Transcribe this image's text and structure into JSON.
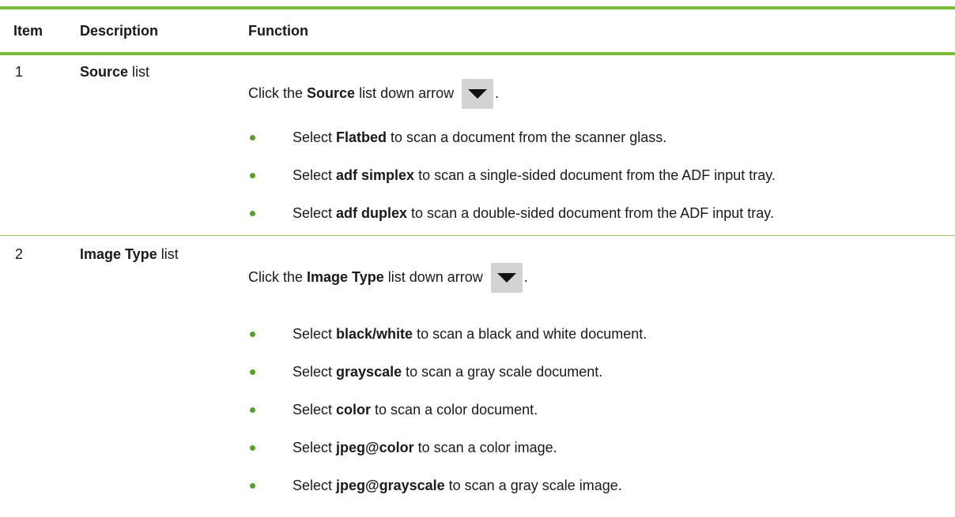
{
  "table": {
    "headers": {
      "item": "Item",
      "description": "Description",
      "function": "Function"
    },
    "rows": [
      {
        "item": "1",
        "desc_bold": "Source",
        "desc_rest": " list",
        "intro_pre": "Click the ",
        "intro_bold": "Source",
        "intro_post": " list down arrow",
        "intro_end": ".",
        "bullets": [
          {
            "pre": "Select ",
            "bold": "Flatbed",
            "post": " to scan a document from the scanner glass."
          },
          {
            "pre": "Select ",
            "bold": "adf simplex",
            "post": " to scan a single-sided document from the ADF input tray."
          },
          {
            "pre": "Select ",
            "bold": "adf duplex",
            "post": " to scan a double-sided document from the ADF input tray."
          }
        ]
      },
      {
        "item": "2",
        "desc_bold": "Image Type",
        "desc_rest": " list",
        "intro_pre": "Click the ",
        "intro_bold": "Image Type",
        "intro_post": " list down arrow",
        "intro_end": ".",
        "bullets": [
          {
            "pre": "Select ",
            "bold": "black/white",
            "post": " to scan a black and white document."
          },
          {
            "pre": "Select ",
            "bold": "grayscale",
            "post": " to scan a gray scale document."
          },
          {
            "pre": "Select ",
            "bold": "color",
            "post": " to scan a color document."
          },
          {
            "pre": "Select ",
            "bold": "jpeg@color",
            "post": " to scan a color image."
          },
          {
            "pre": "Select ",
            "bold": "jpeg@grayscale",
            "post": " to scan a gray scale image."
          }
        ]
      }
    ]
  },
  "colors": {
    "rule": "#7dbb3d",
    "bullet": "#5aa02c",
    "arrow_button": "#d3d3d3"
  },
  "icons": {
    "dropdown": "down-arrow-icon"
  }
}
